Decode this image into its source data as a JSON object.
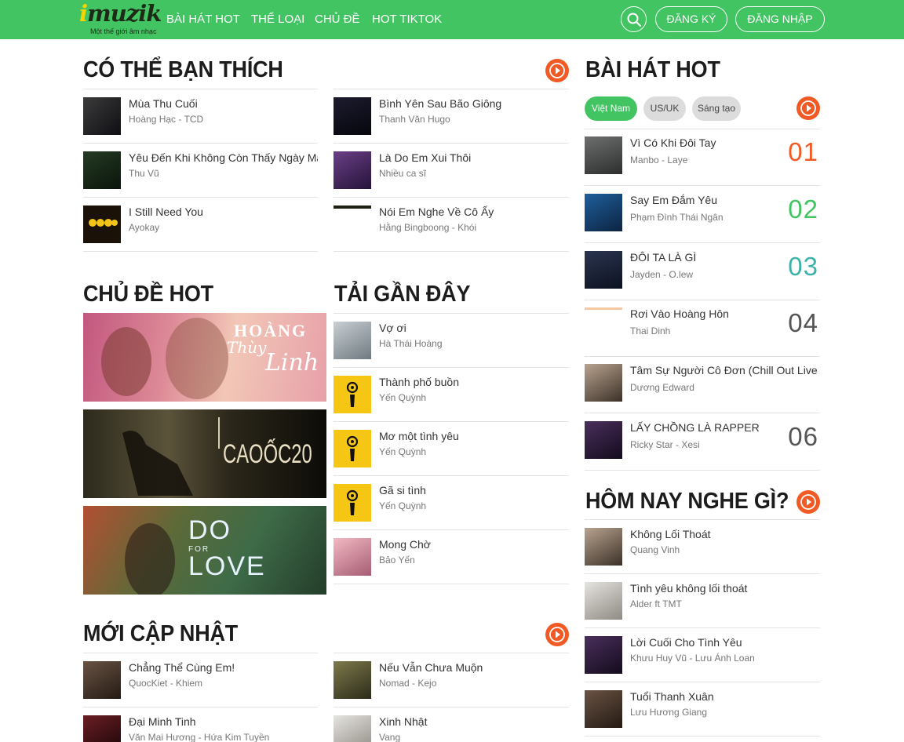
{
  "header": {
    "logo": {
      "word": "muzik",
      "i_letter": "i",
      "tagline": "Một thế giới âm nhạc"
    },
    "nav": [
      "BÀI HÁT HOT",
      "THỂ LOẠI",
      "CHỦ ĐỀ",
      "HOT TIKTOK"
    ],
    "signup_label": "ĐĂNG KÝ",
    "login_label": "ĐĂNG NHẬP"
  },
  "recommend": {
    "title": "CÓ THỂ BẠN THÍCH",
    "songs": [
      {
        "name": "Mùa Thu Cuối",
        "artist": "Hoàng Hạc - TCD"
      },
      {
        "name": "Bình Yên Sau Bão Giông",
        "artist": "Thanh Văn Hugo"
      },
      {
        "name": "Yêu Đến Khi Không Còn Thấy Ngày Mai",
        "artist": "Thu Vũ"
      },
      {
        "name": "Là Do Em Xui Thôi",
        "artist": "Nhiều ca sĩ"
      },
      {
        "name": "I Still Need You",
        "artist": "Ayokay"
      },
      {
        "name": "Nói Em Nghe Về Cô Ấy",
        "artist": "Hằng Bingboong - Khói"
      }
    ]
  },
  "topics": {
    "title": "CHỦ ĐỀ HOT",
    "banners": [
      {
        "line1": "HOÀNG",
        "line2": "Thùy",
        "line3": "Linh"
      },
      {
        "text": "CAOỐC20"
      },
      {
        "line1": "DO",
        "line2": "FOR",
        "line3": "LOVE"
      }
    ]
  },
  "recent": {
    "title": "TẢI GẦN ĐÂY",
    "songs": [
      {
        "name": "Vợ ơi",
        "artist": "Hà Thái Hoàng"
      },
      {
        "name": "Thành phố buồn",
        "artist": "Yến Quỳnh"
      },
      {
        "name": "Mơ một tình yêu",
        "artist": "Yến Quỳnh"
      },
      {
        "name": "Gã si tình",
        "artist": "Yến Quỳnh"
      },
      {
        "name": "Mong Chờ",
        "artist": "Bảo Yến"
      }
    ]
  },
  "new_updates": {
    "title": "MỚI CẬP NHẬT",
    "songs": [
      {
        "name": "Chẳng Thể Cùng Em!",
        "artist": "QuocKiet - Khiem"
      },
      {
        "name": "Nếu Vẫn Chưa Muộn",
        "artist": "Nomad - Kejo"
      },
      {
        "name": "Đại Minh Tinh",
        "artist": "Văn Mai Hương - Hứa Kim Tuyền"
      },
      {
        "name": "Xinh Nhật",
        "artist": "Vang"
      }
    ]
  },
  "hot_songs": {
    "title": "BÀI HÁT HOT",
    "tabs": [
      "Việt Nam",
      "US/UK",
      "Sáng tạo"
    ],
    "active_tab": "Việt Nam",
    "songs": [
      {
        "name": "Vì Có Khi Đôi Tay",
        "artist": "Manbo - Laye",
        "rank": "01",
        "rank_color": "#f25a25"
      },
      {
        "name": "Say Em Đắm Yêu",
        "artist": "Phạm Đình Thái Ngân",
        "rank": "02",
        "rank_color": "#43c463"
      },
      {
        "name": "ĐÔI TA LÀ GÌ",
        "artist": "Jayden - O.lew",
        "rank": "03",
        "rank_color": "#3bb3a8"
      },
      {
        "name": "Rơi Vào Hoàng Hôn",
        "artist": "Thai Dinh",
        "rank": "04",
        "rank_color": "#555555"
      },
      {
        "name": "Tâm Sự Người Cô Đơn (Chill Out Live Session)",
        "artist": "Dương Edward",
        "rank": "",
        "rank_color": "#555555"
      },
      {
        "name": "LẤY CHỒNG LÀ RAPPER",
        "artist": "Ricky Star - Xesi",
        "rank": "06",
        "rank_color": "#555555"
      }
    ]
  },
  "today": {
    "title": "HÔM NAY NGHE GÌ?",
    "songs": [
      {
        "name": "Không Lối Thoát",
        "artist": "Quang Vinh"
      },
      {
        "name": "Tình yêu không lối thoát",
        "artist": "Alder ft TMT"
      },
      {
        "name": "Lời Cuối Cho Tình Yêu",
        "artist": "Khưu Huy Vũ - Lưu Ánh Loan"
      },
      {
        "name": "Tuổi Thanh Xuân",
        "artist": "Lưu Hương Giang"
      }
    ]
  },
  "colors": {
    "brand_green": "#43c463",
    "accent_orange": "#f25a25"
  }
}
